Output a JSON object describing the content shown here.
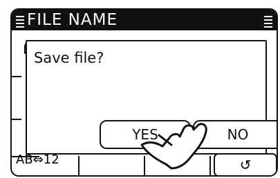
{
  "titlebar": {
    "title": "FILE NAME"
  },
  "dialog": {
    "message": "Save file?",
    "yes_label": "YES",
    "no_label": "NO"
  },
  "bottom": {
    "left_text": "AB⇔12",
    "back_icon_glyph": "↺"
  }
}
